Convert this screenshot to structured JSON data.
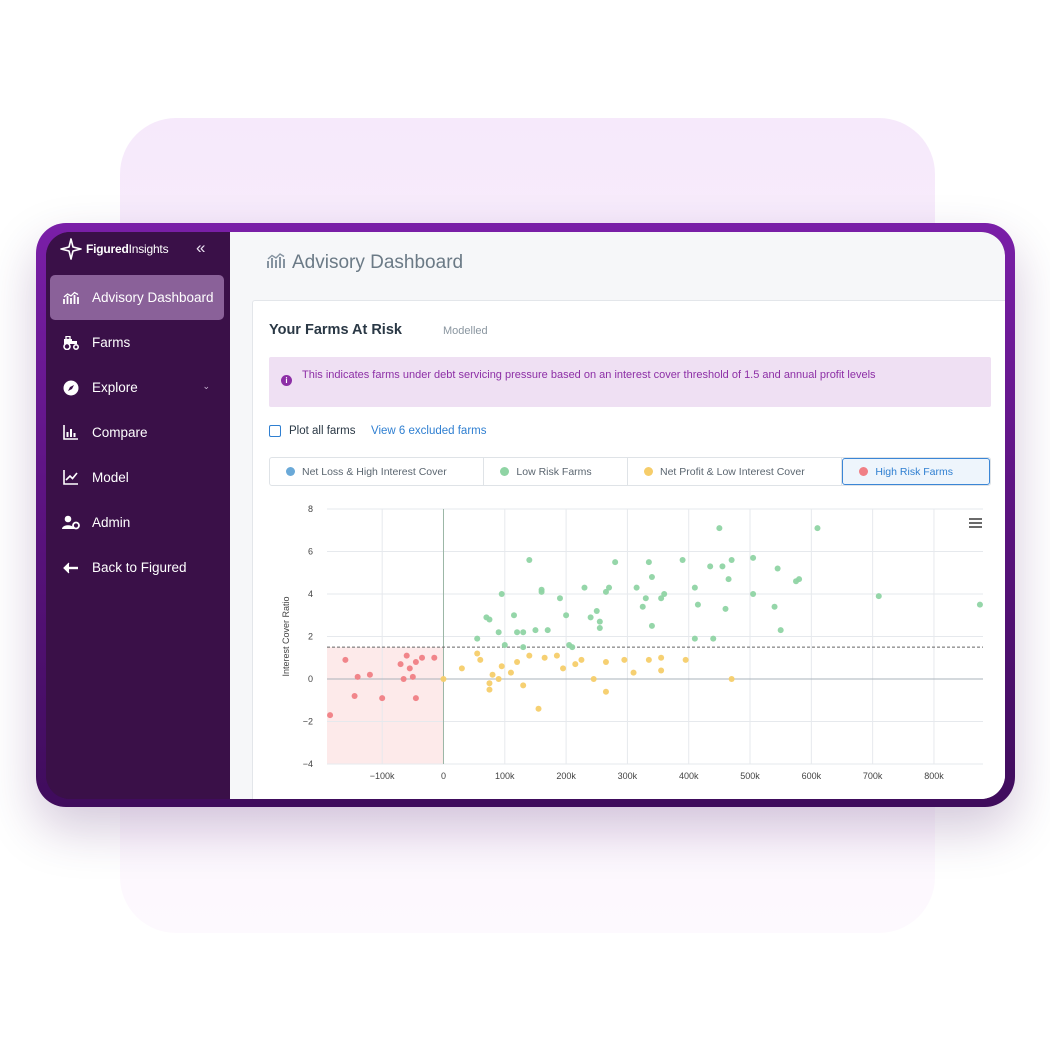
{
  "app": {
    "brand": {
      "bold": "Figured",
      "light": "Insights"
    },
    "collapse_icon": "double-chevron-left-icon"
  },
  "sidebar": {
    "items": [
      {
        "label": "Advisory Dashboard",
        "icon": "chart-bars-icon",
        "active": true
      },
      {
        "label": "Farms",
        "icon": "tractor-icon",
        "active": false
      },
      {
        "label": "Explore",
        "icon": "compass-icon",
        "active": false,
        "has_chevron": true
      },
      {
        "label": "Compare",
        "icon": "bar-chart-icon",
        "active": false
      },
      {
        "label": "Model",
        "icon": "line-chart-icon",
        "active": false
      },
      {
        "label": "Admin",
        "icon": "user-gear-icon",
        "active": false
      },
      {
        "label": "Back to Figured",
        "icon": "arrow-left-icon",
        "active": false
      }
    ]
  },
  "page": {
    "title": "Advisory Dashboard"
  },
  "card": {
    "title": "Your Farms At Risk",
    "subtitle": "Modelled",
    "alert": "This indicates farms under debt servicing pressure based on an interest cover threshold of 1.5 and annual profit levels",
    "plot_all": "Plot all farms",
    "excluded_link": "View 6 excluded farms",
    "legend": [
      {
        "label": "Net Loss & High Interest Cover",
        "color": "#6aa9d8",
        "active": false
      },
      {
        "label": "Low Risk Farms",
        "color": "#8fd4a4",
        "active": false
      },
      {
        "label": "Net Profit & Low Interest Cover",
        "color": "#f6cd6a",
        "active": false
      },
      {
        "label": "High Risk Farms",
        "color": "#f07f85",
        "active": true
      }
    ]
  },
  "colors": {
    "accent": "#8d2fa6",
    "link": "#2f7fd1",
    "low_risk": "#8fd4a4",
    "profit_low_cover": "#f6cd6a",
    "high_risk": "#f07f85"
  },
  "chart_data": {
    "type": "scatter",
    "xlabel": "",
    "ylabel": "Interest Cover Ratio",
    "xlim": [
      -190000,
      880000
    ],
    "ylim": [
      -4,
      8
    ],
    "x_ticks": [
      -100000,
      0,
      100000,
      200000,
      300000,
      400000,
      500000,
      600000,
      700000,
      800000
    ],
    "x_tick_labels": [
      "−100k",
      "0",
      "100k",
      "200k",
      "300k",
      "400k",
      "500k",
      "600k",
      "700k",
      "800k"
    ],
    "y_ticks": [
      -4,
      -2,
      0,
      2,
      4,
      6,
      8
    ],
    "y_tick_labels": [
      "−4",
      "−2",
      "0",
      "2",
      "4",
      "6",
      "8"
    ],
    "threshold": 1.5,
    "grid": true,
    "series": [
      {
        "name": "High Risk Farms",
        "color": "#f07f85",
        "points": [
          [
            -185000,
            -1.7
          ],
          [
            -160000,
            0.9
          ],
          [
            -140000,
            0.1
          ],
          [
            -145000,
            -0.8
          ],
          [
            -120000,
            0.2
          ],
          [
            -100000,
            -0.9
          ],
          [
            -70000,
            0.7
          ],
          [
            -65000,
            0.0
          ],
          [
            -60000,
            1.1
          ],
          [
            -55000,
            0.5
          ],
          [
            -50000,
            0.1
          ],
          [
            -45000,
            0.8
          ],
          [
            -45000,
            -0.9
          ],
          [
            -35000,
            1.0
          ],
          [
            -15000,
            1.0
          ]
        ]
      },
      {
        "name": "Net Profit & Low Interest Cover",
        "color": "#f6cd6a",
        "points": [
          [
            0,
            0.0
          ],
          [
            30000,
            0.5
          ],
          [
            55000,
            1.2
          ],
          [
            60000,
            0.9
          ],
          [
            75000,
            -0.2
          ],
          [
            80000,
            0.2
          ],
          [
            75000,
            -0.5
          ],
          [
            90000,
            0.0
          ],
          [
            95000,
            0.6
          ],
          [
            110000,
            0.3
          ],
          [
            120000,
            0.8
          ],
          [
            130000,
            -0.3
          ],
          [
            140000,
            1.1
          ],
          [
            155000,
            -1.4
          ],
          [
            165000,
            1.0
          ],
          [
            185000,
            1.1
          ],
          [
            195000,
            0.5
          ],
          [
            215000,
            0.7
          ],
          [
            225000,
            0.9
          ],
          [
            245000,
            0.0
          ],
          [
            265000,
            0.8
          ],
          [
            265000,
            -0.6
          ],
          [
            295000,
            0.9
          ],
          [
            310000,
            0.3
          ],
          [
            335000,
            0.9
          ],
          [
            355000,
            1.0
          ],
          [
            355000,
            0.4
          ],
          [
            395000,
            0.9
          ],
          [
            470000,
            0.0
          ]
        ]
      },
      {
        "name": "Low Risk Farms",
        "color": "#8fd4a4",
        "points": [
          [
            55000,
            1.9
          ],
          [
            70000,
            2.9
          ],
          [
            75000,
            2.8
          ],
          [
            90000,
            2.2
          ],
          [
            95000,
            4.0
          ],
          [
            100000,
            1.6
          ],
          [
            115000,
            3.0
          ],
          [
            130000,
            1.5
          ],
          [
            120000,
            2.2
          ],
          [
            130000,
            2.2
          ],
          [
            140000,
            5.6
          ],
          [
            150000,
            2.3
          ],
          [
            160000,
            4.2
          ],
          [
            160000,
            4.1
          ],
          [
            170000,
            2.3
          ],
          [
            190000,
            3.8
          ],
          [
            200000,
            3.0
          ],
          [
            205000,
            1.6
          ],
          [
            210000,
            1.5
          ],
          [
            230000,
            4.3
          ],
          [
            240000,
            2.9
          ],
          [
            250000,
            3.2
          ],
          [
            255000,
            2.7
          ],
          [
            255000,
            2.4
          ],
          [
            265000,
            4.1
          ],
          [
            270000,
            4.3
          ],
          [
            280000,
            5.5
          ],
          [
            315000,
            4.3
          ],
          [
            325000,
            3.4
          ],
          [
            330000,
            3.8
          ],
          [
            335000,
            5.5
          ],
          [
            340000,
            4.8
          ],
          [
            340000,
            2.5
          ],
          [
            355000,
            3.8
          ],
          [
            360000,
            4.0
          ],
          [
            390000,
            5.6
          ],
          [
            410000,
            4.3
          ],
          [
            410000,
            1.9
          ],
          [
            415000,
            3.5
          ],
          [
            435000,
            5.3
          ],
          [
            440000,
            1.9
          ],
          [
            450000,
            7.1
          ],
          [
            455000,
            5.3
          ],
          [
            460000,
            3.3
          ],
          [
            465000,
            4.7
          ],
          [
            470000,
            5.6
          ],
          [
            505000,
            4.0
          ],
          [
            505000,
            5.7
          ],
          [
            540000,
            3.4
          ],
          [
            545000,
            5.2
          ],
          [
            550000,
            2.3
          ],
          [
            575000,
            4.6
          ],
          [
            580000,
            4.7
          ],
          [
            610000,
            7.1
          ],
          [
            710000,
            3.9
          ],
          [
            875000,
            3.5
          ]
        ]
      }
    ]
  }
}
